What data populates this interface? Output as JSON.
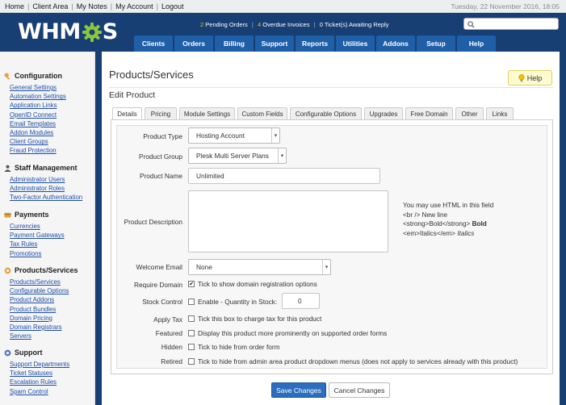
{
  "topnav": [
    "Home",
    "Client Area",
    "My Notes",
    "My Account",
    "Logout"
  ],
  "date": "Tuesday, 22 November 2016, 18:05",
  "logo": "WHM",
  "logo_tail": "S",
  "alerts": {
    "pending_num": "2",
    "pending_label": "Pending Orders",
    "overdue_num": "4",
    "overdue_label": "Overdue Invoices",
    "tickets_num": "0",
    "tickets_label": "Ticket(s) Awaiting Reply"
  },
  "mainnav": [
    "Clients",
    "Orders",
    "Billing",
    "Support",
    "Reports",
    "Utilities",
    "Addons",
    "Setup",
    "Help"
  ],
  "sidebar": [
    {
      "title": "Configuration",
      "links": [
        "General Settings",
        "Automation Settings",
        "Application Links",
        "OpenID Connect",
        "Email Templates",
        "Addon Modules",
        "Client Groups",
        "Fraud Protection"
      ]
    },
    {
      "title": "Staff Management",
      "links": [
        "Administrator Users",
        "Administrator Roles",
        "Two-Factor Authentication"
      ]
    },
    {
      "title": "Payments",
      "links": [
        "Currencies",
        "Payment Gateways",
        "Tax Rules",
        "Promotions"
      ]
    },
    {
      "title": "Products/Services",
      "links": [
        "Products/Services",
        "Configurable Options",
        "Product Addons",
        "Product Bundles",
        "Domain Pricing",
        "Domain Registrars",
        "Servers"
      ]
    },
    {
      "title": "Support",
      "links": [
        "Support Departments",
        "Ticket Statuses",
        "Escalation Rules",
        "Spam Control"
      ]
    }
  ],
  "page_title": "Products/Services",
  "help_label": "Help",
  "section_title": "Edit Product",
  "tabs": [
    "Details",
    "Pricing",
    "Module Settings",
    "Custom Fields",
    "Configurable Options",
    "Upgrades",
    "Free Domain",
    "Other",
    "Links"
  ],
  "form": {
    "product_type_label": "Product Type",
    "product_type_value": "Hosting Account",
    "product_group_label": "Product Group",
    "product_group_value": "Plesk Multi Server Plans",
    "product_name_label": "Product Name",
    "product_name_value": "Unlimited",
    "description_label": "Product Description",
    "hint_line1": "You may use HTML in this field",
    "hint_line2": "<br /> New line",
    "hint_line3_code": "<strong>Bold</strong>",
    "hint_line3_demo": "Bold",
    "hint_line4_code": "<em>Italics</em>",
    "hint_line4_demo": "Italics",
    "welcome_email_label": "Welcome Email",
    "welcome_email_value": "None",
    "require_domain_label": "Require Domain",
    "require_domain_text": "Tick to show domain registration options",
    "stock_control_label": "Stock Control",
    "stock_control_text": "Enable - Quantity in Stock:",
    "stock_qty": "0",
    "apply_tax_label": "Apply Tax",
    "apply_tax_text": "Tick this box to charge tax for this product",
    "featured_label": "Featured",
    "featured_text": "Display this product more prominently on supported order forms",
    "hidden_label": "Hidden",
    "hidden_text": "Tick to hide from order form",
    "retired_label": "Retired",
    "retired_text": "Tick to hide from admin area product dropdown menus (does not apply to services already with this product)"
  },
  "save_label": "Save Changes",
  "cancel_label": "Cancel Changes"
}
